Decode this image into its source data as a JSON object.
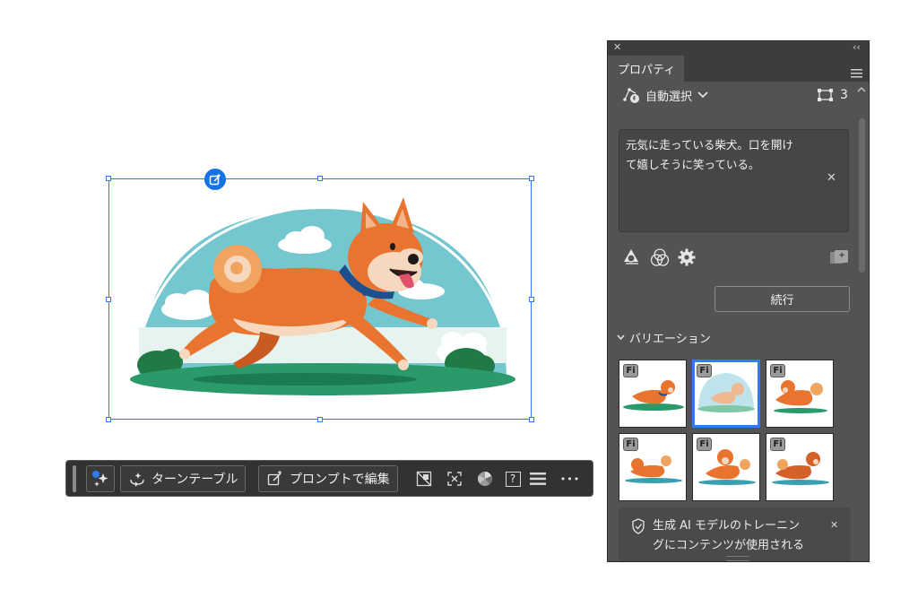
{
  "panel": {
    "tab_label": "プロパティ",
    "selection_mode": "自動選択",
    "layer_count": "3",
    "prompt_text_line1": "元気に走っている柴犬。口を開け",
    "prompt_text_line2": "て嬉しそうに笑っている。",
    "continue_label": "続行",
    "variations_label": "バリエーション",
    "thumbnails": [
      {
        "badge": "Fi",
        "selected": false
      },
      {
        "badge": "Fi",
        "selected": true
      },
      {
        "badge": "Fi",
        "selected": false
      },
      {
        "badge": "Fi",
        "selected": false
      },
      {
        "badge": "Fi",
        "selected": false
      },
      {
        "badge": "Fi",
        "selected": false
      }
    ],
    "notice_line1": "生成 AI モデルのトレーニン",
    "notice_line2": "グにコンテンツが使用される"
  },
  "taskbar": {
    "turntable_label": "ターンテーブル",
    "edit_prompt_label": "プロンプトで編集",
    "help_label": "?",
    "more_label": "•••"
  },
  "colors": {
    "accent": "#2f7bf5",
    "panel_bg": "#535353",
    "taskbar_bg": "#323232",
    "dog_orange": "#e8742f",
    "sky": "#74c6cf",
    "grass": "#2a9a6a"
  }
}
